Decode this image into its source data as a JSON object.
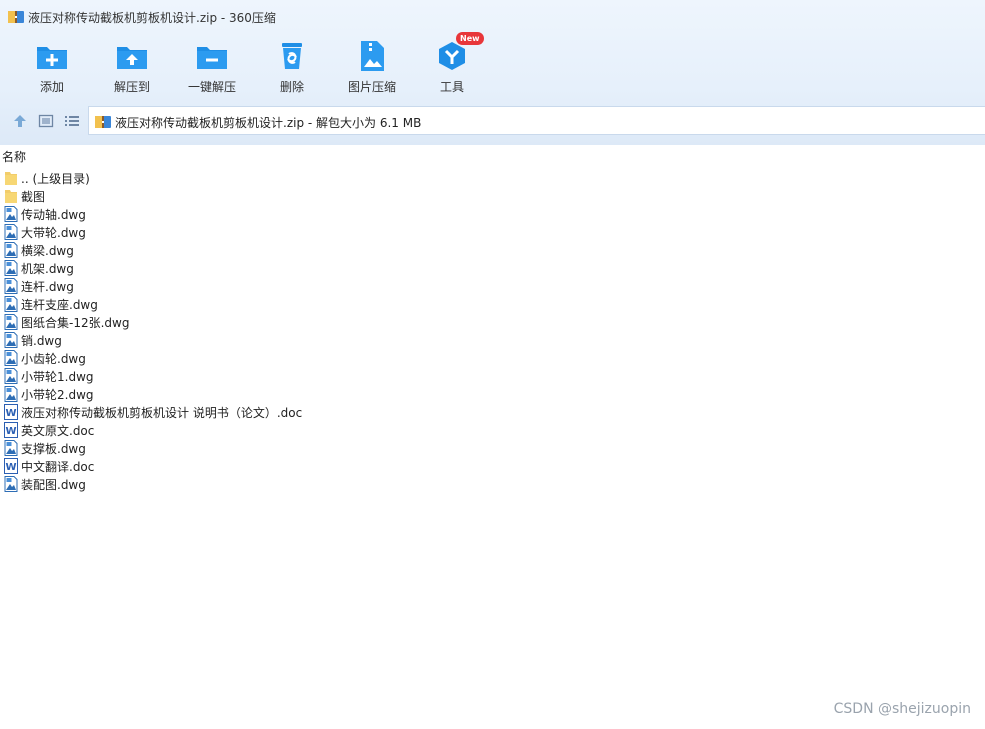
{
  "window": {
    "title": "液压对称传动截板机剪板机设计.zip - 360压缩",
    "app_icon": "zip-archive-icon"
  },
  "toolbar": {
    "buttons": [
      {
        "label": "添加",
        "icon": "add-folder-icon"
      },
      {
        "label": "解压到",
        "icon": "extract-to-icon"
      },
      {
        "label": "一键解压",
        "icon": "one-click-extract-icon"
      },
      {
        "label": "删除",
        "icon": "recycle-bin-icon"
      },
      {
        "label": "图片压缩",
        "icon": "image-compress-icon"
      },
      {
        "label": "工具",
        "icon": "tools-icon",
        "badge": "New"
      }
    ]
  },
  "navbar": {
    "path_text": "液压对称传动截板机剪板机设计.zip - 解包大小为 6.1 MB"
  },
  "list": {
    "column_name": "名称",
    "items": [
      {
        "name": ".. (上级目录)",
        "type": "folder"
      },
      {
        "name": "截图",
        "type": "folder"
      },
      {
        "name": "传动轴.dwg",
        "type": "dwg"
      },
      {
        "name": "大带轮.dwg",
        "type": "dwg"
      },
      {
        "name": "横梁.dwg",
        "type": "dwg"
      },
      {
        "name": "机架.dwg",
        "type": "dwg"
      },
      {
        "name": "连杆.dwg",
        "type": "dwg"
      },
      {
        "name": "连杆支座.dwg",
        "type": "dwg"
      },
      {
        "name": "图纸合集-12张.dwg",
        "type": "dwg"
      },
      {
        "name": "销.dwg",
        "type": "dwg"
      },
      {
        "name": "小齿轮.dwg",
        "type": "dwg"
      },
      {
        "name": "小带轮1.dwg",
        "type": "dwg"
      },
      {
        "name": "小带轮2.dwg",
        "type": "dwg"
      },
      {
        "name": "液压对称传动截板机剪板机设计 说明书（论文）.doc",
        "type": "doc"
      },
      {
        "name": "英文原文.doc",
        "type": "doc"
      },
      {
        "name": "支撑板.dwg",
        "type": "dwg"
      },
      {
        "name": "中文翻译.doc",
        "type": "doc"
      },
      {
        "name": "装配图.dwg",
        "type": "dwg"
      }
    ]
  },
  "watermark": "CSDN @shejizuopin",
  "colors": {
    "accent_blue": "#1f8ee6",
    "badge_red": "#e8363a",
    "folder_yellow": "#f7d774"
  }
}
